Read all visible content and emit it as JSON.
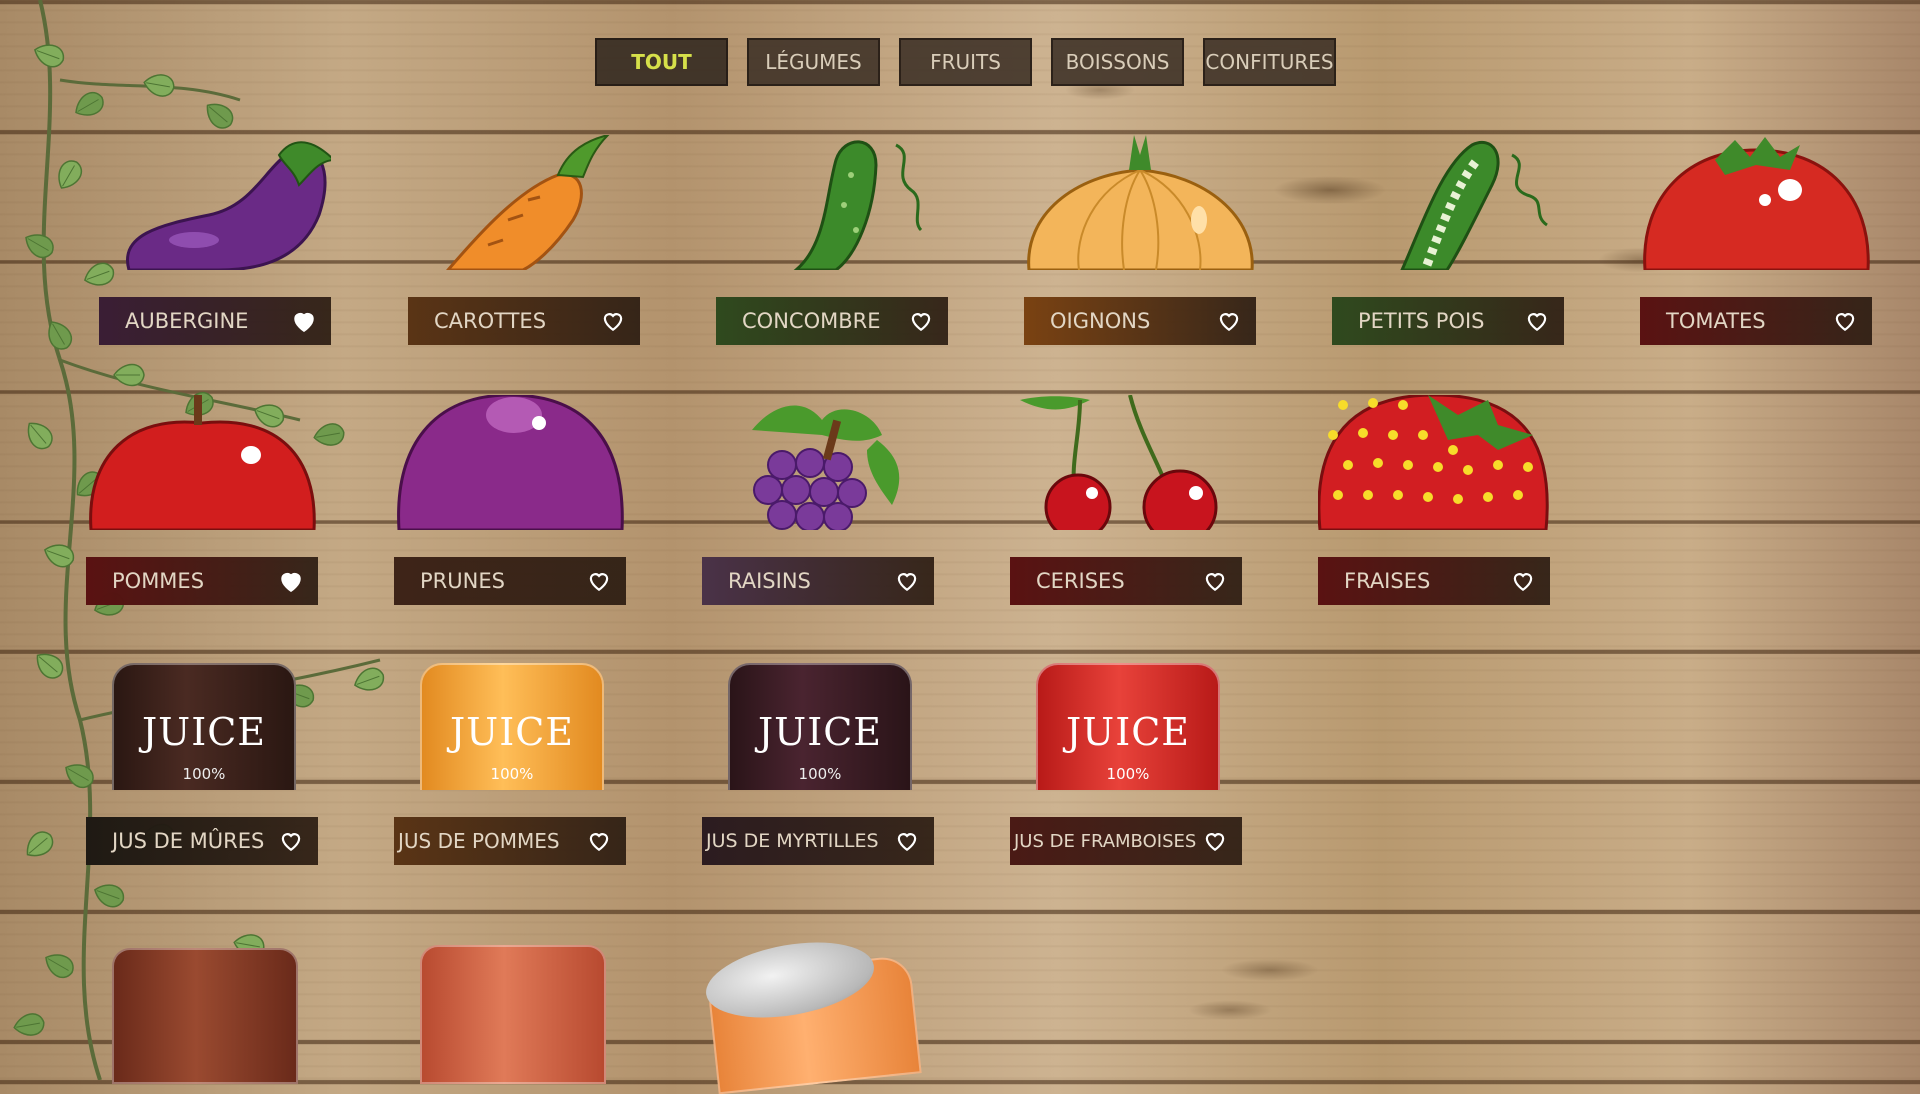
{
  "nav": {
    "tabs": [
      {
        "label": "TOUT",
        "active": true
      },
      {
        "label": "LÉGUMES",
        "active": false
      },
      {
        "label": "FRUITS",
        "active": false
      },
      {
        "label": "BOISSONS",
        "active": false
      },
      {
        "label": "CONFITURES",
        "active": false
      }
    ]
  },
  "vegetables": [
    {
      "name": "AUBERGINE",
      "favorite": true,
      "icon": "eggplant-icon",
      "color": "#3a1e35"
    },
    {
      "name": "CAROTTES",
      "favorite": false,
      "icon": "carrot-icon",
      "color": "#5a3415"
    },
    {
      "name": "CONCOMBRE",
      "favorite": false,
      "icon": "cucumber-icon",
      "color": "#2f4a1e"
    },
    {
      "name": "OIGNONS",
      "favorite": false,
      "icon": "onion-icon",
      "color": "#7a4212"
    },
    {
      "name": "PETITS POIS",
      "favorite": false,
      "icon": "peas-icon",
      "color": "#2f4a1e"
    },
    {
      "name": "TOMATES",
      "favorite": false,
      "icon": "tomato-icon",
      "color": "#5a1212"
    }
  ],
  "fruits": [
    {
      "name": "POMMES",
      "favorite": true,
      "icon": "apple-icon",
      "color": "#5a1212"
    },
    {
      "name": "PRUNES",
      "favorite": false,
      "icon": "plum-icon",
      "color": "#3e2418"
    },
    {
      "name": "RAISINS",
      "favorite": false,
      "icon": "grapes-icon",
      "color": "#4a3248"
    },
    {
      "name": "CERISES",
      "favorite": false,
      "icon": "cherries-icon",
      "color": "#5a1212"
    },
    {
      "name": "FRAISES",
      "favorite": false,
      "icon": "strawberry-icon",
      "color": "#5a1212"
    }
  ],
  "drinks": [
    {
      "name": "JUS DE MÛRES",
      "favorite": false,
      "jar_text": "JUICE",
      "jar_sub": "100%",
      "color": "#1f1a14"
    },
    {
      "name": "JUS DE POMMES",
      "favorite": false,
      "jar_text": "JUICE",
      "jar_sub": "100%",
      "color": "#5a3415"
    },
    {
      "name": "JUS DE MYRTILLES",
      "favorite": false,
      "jar_text": "JUICE",
      "jar_sub": "100%",
      "color": "#2c1c20"
    },
    {
      "name": "JUS DE FRAMBOISES",
      "favorite": false,
      "jar_text": "JUICE",
      "jar_sub": "100%",
      "color": "#4a1a15"
    }
  ]
}
